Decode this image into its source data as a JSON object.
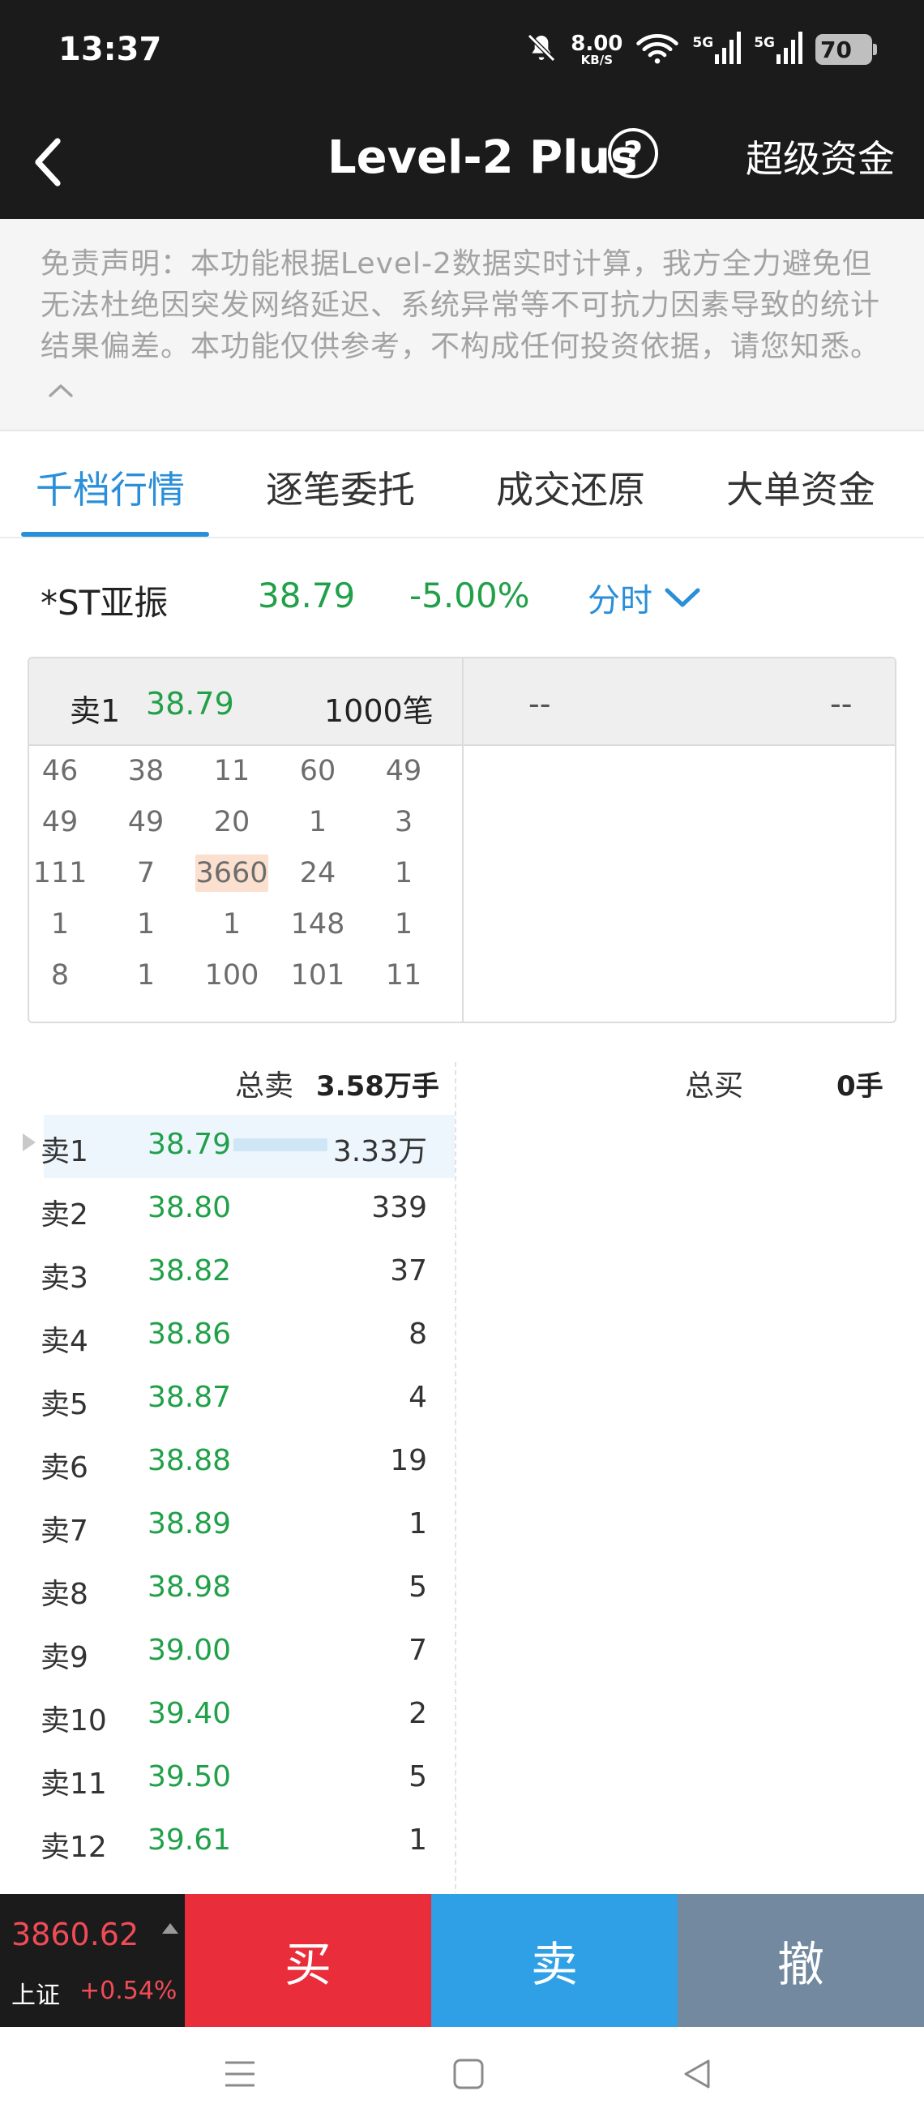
{
  "status_bar": {
    "time": "13:37",
    "speed_value": "8.00",
    "speed_unit": "KB/S",
    "network_1": "5G",
    "network_2": "5G",
    "battery": "70",
    "icons": [
      "bell-off-icon",
      "wifi-icon",
      "signal-icon",
      "signal-icon",
      "battery-icon"
    ]
  },
  "header": {
    "title": "Level-2 Plus",
    "help": "?",
    "right_action": "超级资金"
  },
  "disclaimer": {
    "text": "免责声明：本功能根据Level-2数据实时计算，我方全力避免但无法杜绝因突发网络延迟、系统异常等不可抗力因素导致的统计结果偏差。本功能仅供参考，不构成任何投资依据，请您知悉。"
  },
  "tabs": [
    {
      "label": "千档行情",
      "active": true
    },
    {
      "label": "逐笔委托",
      "active": false
    },
    {
      "label": "成交还原",
      "active": false
    },
    {
      "label": "大单资金",
      "active": false
    }
  ],
  "stock": {
    "name": "*ST亚振",
    "price": "38.79",
    "change": "-5.00%",
    "period": "分时"
  },
  "queue": {
    "left_label": "卖1",
    "left_price": "38.79",
    "left_count": "1000笔",
    "right_a": "--",
    "right_b": "--",
    "rows": [
      [
        "46",
        "38",
        "11",
        "60",
        "49"
      ],
      [
        "49",
        "49",
        "20",
        "1",
        "3"
      ],
      [
        "111",
        "7",
        "3660",
        "24",
        "1"
      ],
      [
        "1",
        "1",
        "1",
        "148",
        "1"
      ],
      [
        "8",
        "1",
        "100",
        "101",
        "11"
      ]
    ],
    "highlighted": "3660"
  },
  "book": {
    "total_sell_label": "总卖",
    "total_sell_value": "3.58万手",
    "total_buy_label": "总买",
    "total_buy_value": "0手",
    "asks": [
      {
        "label": "卖1",
        "price": "38.79",
        "volume": "3.33万"
      },
      {
        "label": "卖2",
        "price": "38.80",
        "volume": "339"
      },
      {
        "label": "卖3",
        "price": "38.82",
        "volume": "37"
      },
      {
        "label": "卖4",
        "price": "38.86",
        "volume": "8"
      },
      {
        "label": "卖5",
        "price": "38.87",
        "volume": "4"
      },
      {
        "label": "卖6",
        "price": "38.88",
        "volume": "19"
      },
      {
        "label": "卖7",
        "price": "38.89",
        "volume": "1"
      },
      {
        "label": "卖8",
        "price": "38.98",
        "volume": "5"
      },
      {
        "label": "卖9",
        "price": "39.00",
        "volume": "7"
      },
      {
        "label": "卖10",
        "price": "39.40",
        "volume": "2"
      },
      {
        "label": "卖11",
        "price": "39.50",
        "volume": "5"
      },
      {
        "label": "卖12",
        "price": "39.61",
        "volume": "1"
      }
    ]
  },
  "index": {
    "value": "3860.62",
    "name": "上证",
    "change": "+0.54%"
  },
  "trade": {
    "buy": "买",
    "sell": "卖",
    "cancel": "撤"
  },
  "colors": {
    "green": "#21a04a",
    "red": "#ea2d3a",
    "blue": "#30a0e6",
    "slate": "#7289a0",
    "header": "#1b1b1b"
  }
}
